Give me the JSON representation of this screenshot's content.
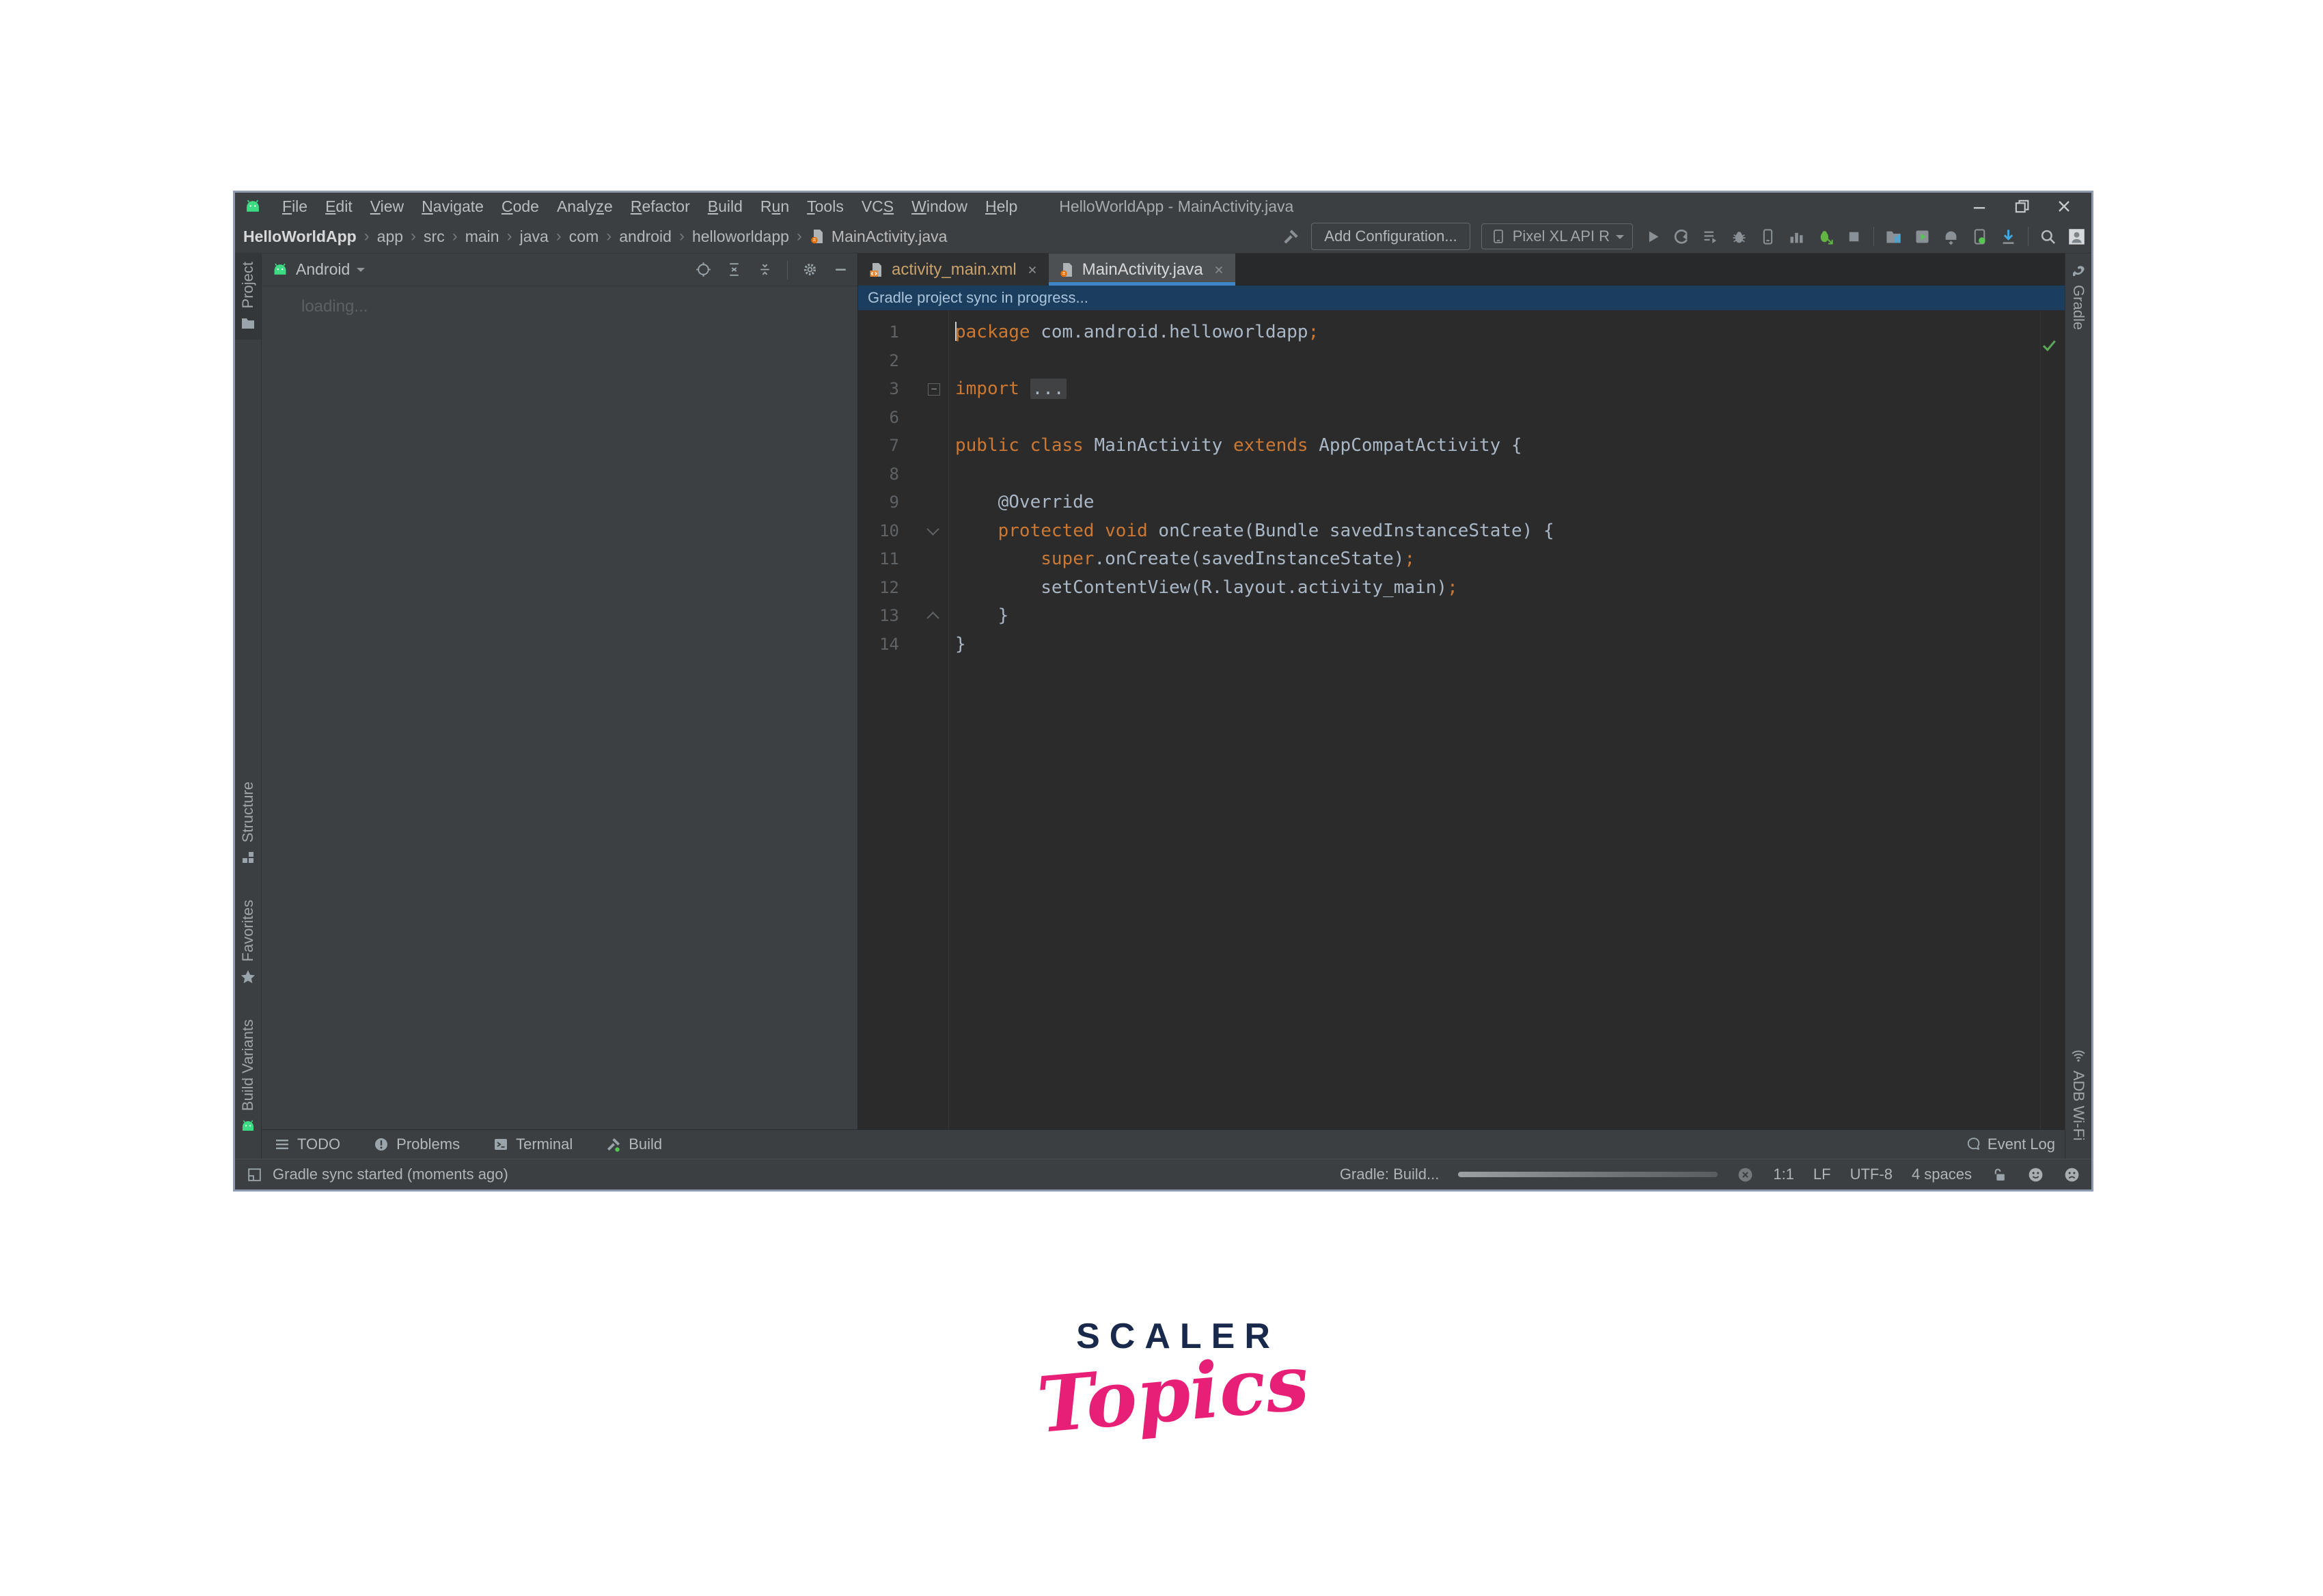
{
  "colors": {
    "window_border": "#8d9cb2",
    "chrome_bg": "#3c3f41",
    "editor_bg": "#2b2b2b",
    "banner_bg": "#1c3e5e",
    "accent_blue": "#3e86c7",
    "keyword_orange": "#cc7832",
    "code_text": "#a9b7c6",
    "android_green": "#3ddc84",
    "logo_navy": "#18294b",
    "logo_pink": "#e81f76"
  },
  "window": {
    "title": "HelloWorldApp - MainActivity.java",
    "menu_items": [
      {
        "label": "File",
        "mnemonic": 0
      },
      {
        "label": "Edit",
        "mnemonic": 0
      },
      {
        "label": "View",
        "mnemonic": 0
      },
      {
        "label": "Navigate",
        "mnemonic": 0
      },
      {
        "label": "Code",
        "mnemonic": 0
      },
      {
        "label": "Analyze",
        "mnemonic": 5
      },
      {
        "label": "Refactor",
        "mnemonic": 0
      },
      {
        "label": "Build",
        "mnemonic": 0
      },
      {
        "label": "Run",
        "mnemonic": 1
      },
      {
        "label": "Tools",
        "mnemonic": 0
      },
      {
        "label": "VCS",
        "mnemonic": 2
      },
      {
        "label": "Window",
        "mnemonic": 0
      },
      {
        "label": "Help",
        "mnemonic": 0
      }
    ],
    "controls": [
      "minimize-icon",
      "restore-icon",
      "close-icon"
    ]
  },
  "toolbar": {
    "breadcrumbs": [
      "HelloWorldApp",
      "app",
      "src",
      "main",
      "java",
      "com",
      "android",
      "helloworldapp"
    ],
    "breadcrumb_separator": "›",
    "file": "MainActivity.java",
    "file_icon": "java-file-icon",
    "add_configuration": "Add Configuration...",
    "device": "Pixel XL API R",
    "right_icons": [
      "run-icon",
      "apply-changes-icon",
      "run-tasks-icon",
      "debug-icon",
      "profile-app-icon",
      "profiler-icon",
      "attach-debugger-icon",
      "stop-icon",
      "sep",
      "sync-gradle-icon",
      "avd-manager-icon",
      "sdk-manager-icon",
      "layout-inspector-icon",
      "get-device-icon",
      "sep",
      "search-everywhere-icon",
      "user-avatar-icon"
    ]
  },
  "project_panel": {
    "selector": "Android",
    "header_icons": [
      "locate-icon",
      "expand-all-icon",
      "collapse-all-icon",
      "sep",
      "settings-gear-icon",
      "hide-icon"
    ],
    "loading_text": "loading..."
  },
  "left_stripe": {
    "items": [
      {
        "label": "Project",
        "icon": "folder-icon",
        "active": true
      },
      {
        "label": "Structure",
        "icon": "structure-icon",
        "active": false
      },
      {
        "label": "Favorites",
        "icon": "star-icon",
        "active": false
      },
      {
        "label": "Build Variants",
        "icon": "android-icon",
        "active": false
      }
    ]
  },
  "right_stripe": {
    "items": [
      {
        "label": "Gradle",
        "icon": "gradle-icon",
        "active": false
      },
      {
        "label": "ADB Wi-Fi",
        "icon": "wifi-icon",
        "active": false
      }
    ]
  },
  "editor": {
    "tabs": [
      {
        "label": "activity_main.xml",
        "icon": "xml-file-icon",
        "active": false
      },
      {
        "label": "MainActivity.java",
        "icon": "java-file-icon",
        "active": true
      }
    ],
    "banner": "Gradle project sync in progress...",
    "lines": [
      {
        "num": "1",
        "caret": true,
        "tokens": [
          {
            "c": "k",
            "t": "package"
          },
          {
            "c": "p",
            "t": " com.android.helloworldapp"
          },
          {
            "c": "s",
            "t": ";"
          }
        ]
      },
      {
        "num": "2",
        "tokens": []
      },
      {
        "num": "3",
        "gutter": "fold-box",
        "tokens": [
          {
            "c": "k",
            "t": "import"
          },
          {
            "c": "p",
            "t": " "
          },
          {
            "c": "f",
            "t": "..."
          }
        ]
      },
      {
        "num": "6",
        "tokens": []
      },
      {
        "num": "7",
        "tokens": [
          {
            "c": "k",
            "t": "public class"
          },
          {
            "c": "p",
            "t": " MainActivity "
          },
          {
            "c": "k",
            "t": "extends"
          },
          {
            "c": "p",
            "t": " AppCompatActivity {"
          }
        ]
      },
      {
        "num": "8",
        "tokens": []
      },
      {
        "num": "9",
        "tokens": [
          {
            "c": "p",
            "t": "    @Override"
          }
        ]
      },
      {
        "num": "10",
        "gutter": "fold-down",
        "tokens": [
          {
            "c": "p",
            "t": "    "
          },
          {
            "c": "k",
            "t": "protected void"
          },
          {
            "c": "p",
            "t": " onCreate(Bundle savedInstanceState) {"
          }
        ]
      },
      {
        "num": "11",
        "tokens": [
          {
            "c": "p",
            "t": "        "
          },
          {
            "c": "k",
            "t": "super"
          },
          {
            "c": "p",
            "t": ".onCreate(savedInstanceState)"
          },
          {
            "c": "s",
            "t": ";"
          }
        ]
      },
      {
        "num": "12",
        "tokens": [
          {
            "c": "p",
            "t": "        setContentView(R.layout.activity_main)"
          },
          {
            "c": "s",
            "t": ";"
          }
        ]
      },
      {
        "num": "13",
        "gutter": "fold-up",
        "tokens": [
          {
            "c": "p",
            "t": "    }"
          }
        ]
      },
      {
        "num": "14",
        "tokens": [
          {
            "c": "p",
            "t": "}"
          }
        ]
      }
    ],
    "inspection_icon": "inspections-ok-icon"
  },
  "bottom_bar": {
    "tabs": [
      {
        "label": "TODO",
        "icon": "todo-icon"
      },
      {
        "label": "Problems",
        "icon": "problems-icon"
      },
      {
        "label": "Terminal",
        "icon": "terminal-icon"
      },
      {
        "label": "Build",
        "icon": "build-icon"
      }
    ],
    "event_log": {
      "label": "Event Log",
      "icon": "event-log-icon"
    }
  },
  "status_bar": {
    "left_message": "Gradle sync started (moments ago)",
    "task_label": "Gradle: Build...",
    "caret_position": "1:1",
    "line_separator": "LF",
    "encoding": "UTF-8",
    "indent": "4 spaces",
    "icons": [
      "tool-windows-icon",
      "cancel-icon",
      "unlock-icon",
      "happy-face-icon",
      "sad-face-icon"
    ]
  },
  "logo": {
    "primary": "SCALER",
    "secondary": "Topics"
  }
}
